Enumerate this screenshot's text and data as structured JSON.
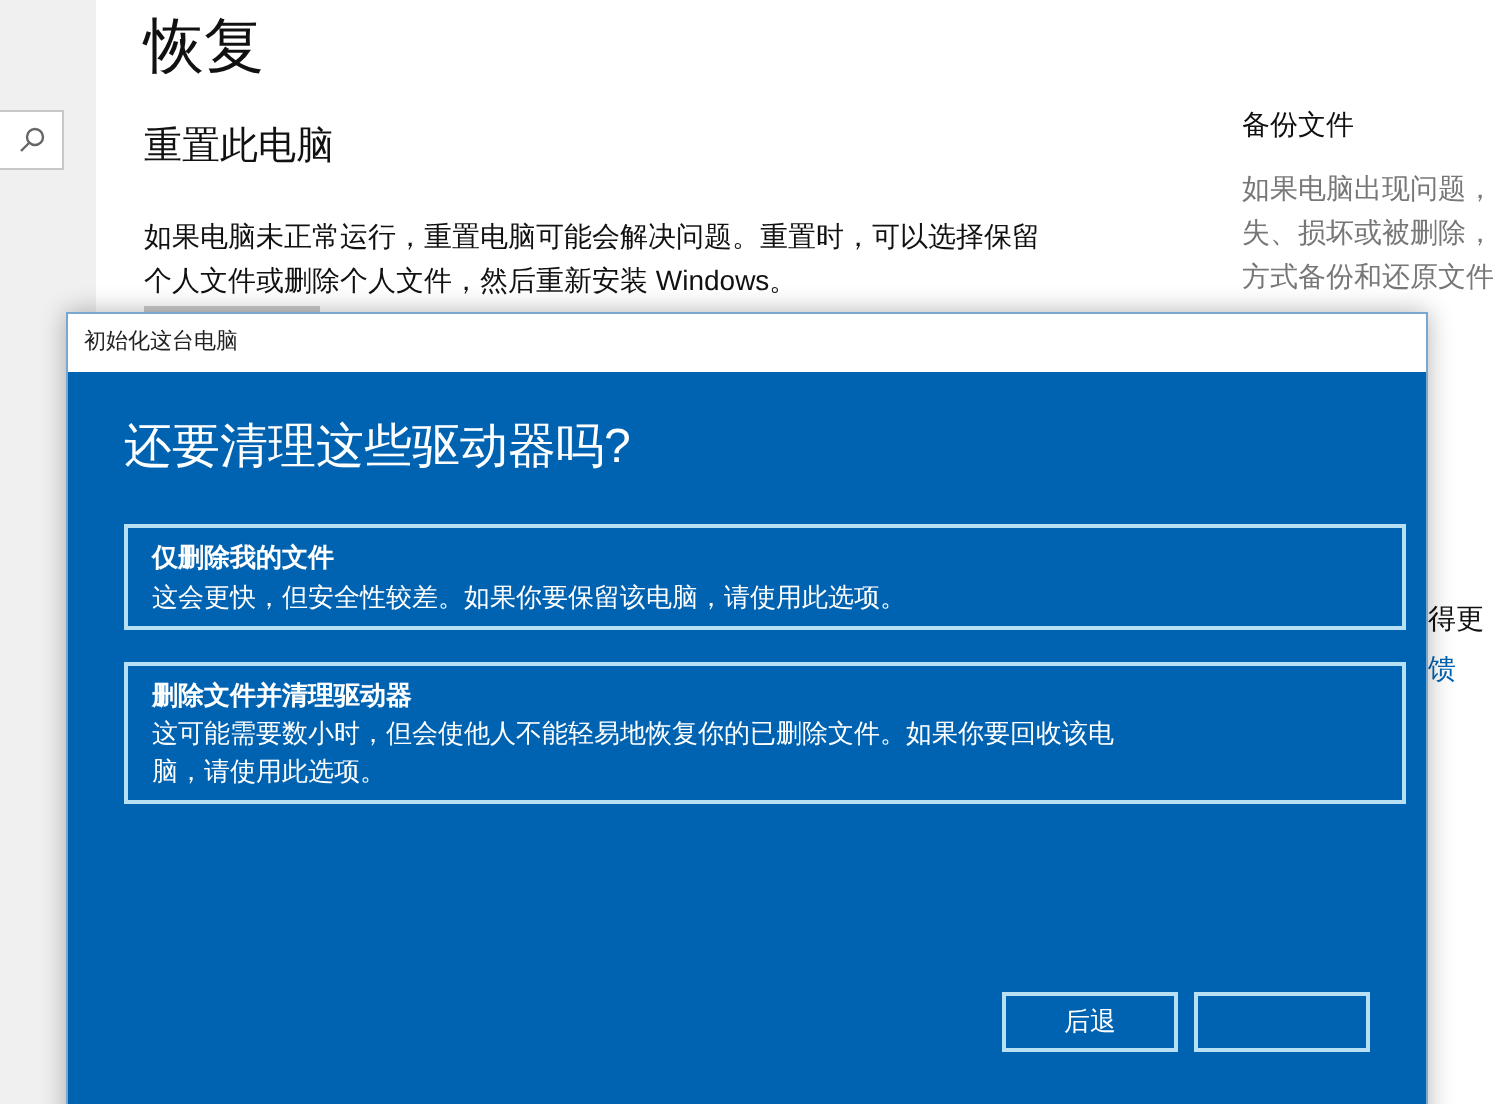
{
  "page": {
    "title": "恢复",
    "section_title": "重置此电脑",
    "description": "如果电脑未正常运行，重置电脑可能会解决问题。重置时，可以选择保留个人文件或删除个人文件，然后重新安装 Windows。"
  },
  "side_panel": {
    "title": "备份文件",
    "lines": [
      "如果电脑出现问题，",
      "失、损坏或被删除，",
      "方式备份和还原文件"
    ],
    "partial_text": "得更",
    "partial_link": "馈"
  },
  "dialog": {
    "title": "初始化这台电脑",
    "heading": "还要清理这些驱动器吗?",
    "options": [
      {
        "title": "仅删除我的文件",
        "description": "这会更快，但安全性较差。如果你要保留该电脑，请使用此选项。"
      },
      {
        "title": "删除文件并清理驱动器",
        "description": "这可能需要数小时，但会使他人不能轻易地恢复你的已删除文件。如果你要回收该电脑，请使用此选项。"
      }
    ],
    "buttons": [
      {
        "kind": "text",
        "label": "后退"
      },
      {
        "kind": "blank"
      }
    ]
  }
}
